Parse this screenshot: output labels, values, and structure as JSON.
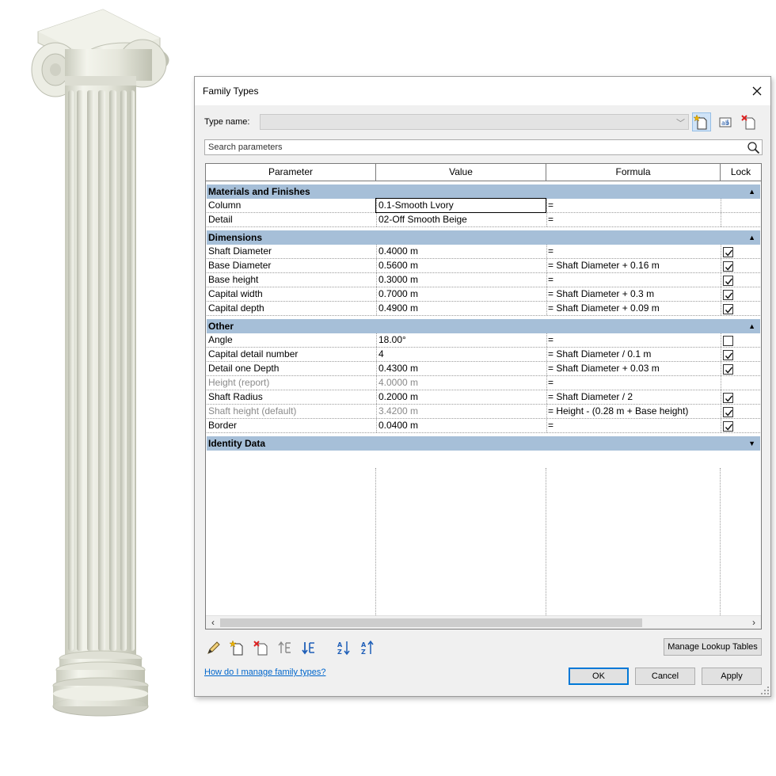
{
  "dialog": {
    "title": "Family Types",
    "type_name_label": "Type name:",
    "type_name_value": "",
    "search_placeholder": "Search parameters"
  },
  "grid": {
    "headers": {
      "parameter": "Parameter",
      "value": "Value",
      "formula": "Formula",
      "lock": "Lock"
    },
    "groups": [
      {
        "name": "Materials and Finishes",
        "toggle": "▲",
        "rows": [
          {
            "parameter": "Column",
            "value": "0.1-Smooth Lvory",
            "formula": "="
          },
          {
            "parameter": "Detail",
            "value": "02-Off Smooth Beige",
            "formula": "="
          }
        ]
      },
      {
        "name": "Dimensions",
        "toggle": "▲",
        "rows": [
          {
            "parameter": "Shaft Diameter",
            "value": "0.4000 m",
            "formula": "=",
            "lock": true
          },
          {
            "parameter": "Base Diameter",
            "value": "0.5600 m",
            "formula": "= Shaft Diameter + 0.16 m",
            "lock": true
          },
          {
            "parameter": "Base height",
            "value": "0.3000 m",
            "formula": "=",
            "lock": true
          },
          {
            "parameter": "Capital width",
            "value": "0.7000 m",
            "formula": "= Shaft Diameter + 0.3 m",
            "lock": true
          },
          {
            "parameter": "Capital depth",
            "value": "0.4900 m",
            "formula": "= Shaft Diameter + 0.09 m",
            "lock": true
          }
        ]
      },
      {
        "name": "Other",
        "toggle": "▲",
        "rows": [
          {
            "parameter": "Angle",
            "value": "18.00°",
            "formula": "=",
            "lock": false
          },
          {
            "parameter": "Capital detail number",
            "value": "4",
            "formula": "= Shaft Diameter / 0.1 m",
            "lock": true
          },
          {
            "parameter": "Detail one Depth",
            "value": "0.4300 m",
            "formula": "= Shaft Diameter + 0.03 m",
            "lock": true
          },
          {
            "parameter": "Height (report)",
            "value": "4.0000 m",
            "formula": "=",
            "greyed": true
          },
          {
            "parameter": "Shaft Radius",
            "value": "0.2000 m",
            "formula": "= Shaft Diameter / 2",
            "lock": true
          },
          {
            "parameter": "Shaft height (default)",
            "value": "3.4200 m",
            "formula": "= Height - (0.28 m + Base height)",
            "lock": true,
            "greyed": true
          },
          {
            "parameter": "Border",
            "value": "0.0400 m",
            "formula": "=",
            "lock": true
          }
        ]
      },
      {
        "name": "Identity Data",
        "toggle": "▼",
        "rows": []
      }
    ]
  },
  "toolbar": {
    "icons": [
      "pencil-icon",
      "new-parameter-icon",
      "delete-parameter-icon",
      "move-up-icon",
      "move-down-icon",
      "sort-ascending-icon",
      "sort-descending-icon"
    ],
    "manage_lookup_label": "Manage Lookup Tables"
  },
  "footer": {
    "help_link": "How do I manage family types?",
    "ok_label": "OK",
    "cancel_label": "Cancel",
    "apply_label": "Apply"
  },
  "colors": {
    "group_header_bg": "#a6bfd8",
    "link": "#0066cc",
    "ok_border": "#0078d7",
    "column_stone": "#e8e9df"
  }
}
